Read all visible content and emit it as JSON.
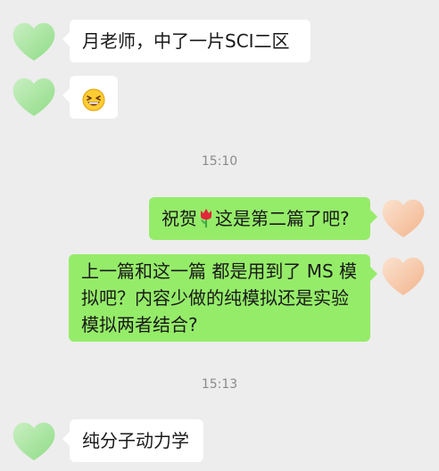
{
  "colors": {
    "background": "#ededed",
    "incoming_bubble": "#ffffff",
    "outgoing_bubble": "#95ec69",
    "timestamp_text": "#8a8a8a",
    "avatar_left": "#a8e6a0",
    "avatar_right": "#f7c9a8"
  },
  "messages": [
    {
      "side": "incoming",
      "text": "月老师，中了一片SCI二区"
    },
    {
      "side": "incoming",
      "emoji": "grinning-face-with-squinting-eyes"
    },
    {
      "timestamp": "15:10"
    },
    {
      "side": "outgoing",
      "text_before": "祝贺",
      "emoji": "tulip",
      "text_after": "这是第二篇了吧?"
    },
    {
      "side": "outgoing",
      "lines": [
        "上一篇和这一篇 都是用到了 MS 模",
        "拟吧？内容少做的纯模拟还是实验",
        "模拟两者结合?"
      ]
    },
    {
      "timestamp": "15:13"
    },
    {
      "side": "incoming",
      "text": "纯分子动力学"
    }
  ]
}
